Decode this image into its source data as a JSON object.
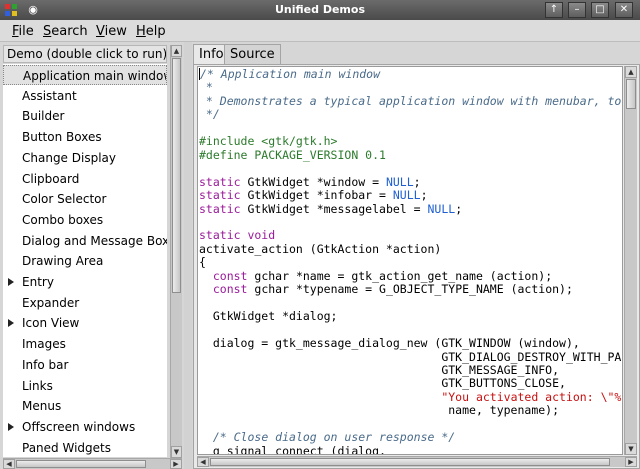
{
  "window": {
    "title": "Unified Demos",
    "buttons": [
      "↑",
      "–",
      "□",
      "✕"
    ]
  },
  "menubar": {
    "items": [
      {
        "label": "File",
        "mnemonic": "F",
        "rest": "ile"
      },
      {
        "label": "Search",
        "mnemonic": "S",
        "rest": "earch"
      },
      {
        "label": "View",
        "mnemonic": "V",
        "rest": "iew"
      },
      {
        "label": "Help",
        "mnemonic": "H",
        "rest": "elp"
      }
    ]
  },
  "demo_list": {
    "header": "Demo (double click to run)",
    "items": [
      {
        "label": "Application main window",
        "expandable": false,
        "selected": true
      },
      {
        "label": "Assistant",
        "expandable": false
      },
      {
        "label": "Builder",
        "expandable": false
      },
      {
        "label": "Button Boxes",
        "expandable": false
      },
      {
        "label": "Change Display",
        "expandable": false
      },
      {
        "label": "Clipboard",
        "expandable": false
      },
      {
        "label": "Color Selector",
        "expandable": false
      },
      {
        "label": "Combo boxes",
        "expandable": false
      },
      {
        "label": "Dialog and Message Boxes",
        "expandable": false
      },
      {
        "label": "Drawing Area",
        "expandable": false
      },
      {
        "label": "Entry",
        "expandable": true
      },
      {
        "label": "Expander",
        "expandable": false
      },
      {
        "label": "Icon View",
        "expandable": true
      },
      {
        "label": "Images",
        "expandable": false
      },
      {
        "label": "Info bar",
        "expandable": false
      },
      {
        "label": "Links",
        "expandable": false
      },
      {
        "label": "Menus",
        "expandable": false
      },
      {
        "label": "Offscreen windows",
        "expandable": true
      },
      {
        "label": "Paned Widgets",
        "expandable": false
      }
    ]
  },
  "tabs": [
    {
      "label": "Info",
      "active": true
    },
    {
      "label": "Source",
      "active": false
    }
  ],
  "source_lines": [
    [
      [
        "c",
        "/* Application main window"
      ]
    ],
    [
      [
        "c",
        " *"
      ]
    ],
    [
      [
        "c",
        " * Demonstrates a typical application window with menubar, toolbar, statusbar."
      ]
    ],
    [
      [
        "c",
        " */"
      ]
    ],
    [
      [
        "p",
        ""
      ]
    ],
    [
      [
        "p",
        "#include <gtk/gtk.h>"
      ]
    ],
    [
      [
        "p",
        "#define PACKAGE_VERSION 0.1"
      ]
    ],
    [
      [
        "t",
        ""
      ]
    ],
    [
      [
        "k",
        "static "
      ],
      [
        "t",
        "GtkWidget *window = "
      ],
      [
        "n",
        "NULL"
      ],
      [
        "t",
        ";"
      ]
    ],
    [
      [
        "k",
        "static "
      ],
      [
        "t",
        "GtkWidget *infobar = "
      ],
      [
        "n",
        "NULL"
      ],
      [
        "t",
        ";"
      ]
    ],
    [
      [
        "k",
        "static "
      ],
      [
        "t",
        "GtkWidget *messagelabel = "
      ],
      [
        "n",
        "NULL"
      ],
      [
        "t",
        ";"
      ]
    ],
    [
      [
        "t",
        ""
      ]
    ],
    [
      [
        "k",
        "static void"
      ]
    ],
    [
      [
        "t",
        "activate_action (GtkAction *action)"
      ]
    ],
    [
      [
        "t",
        "{"
      ]
    ],
    [
      [
        "t",
        "  "
      ],
      [
        "k",
        "const "
      ],
      [
        "t",
        "gchar *name = gtk_action_get_name (action);"
      ]
    ],
    [
      [
        "t",
        "  "
      ],
      [
        "k",
        "const "
      ],
      [
        "t",
        "gchar *typename = G_OBJECT_TYPE_NAME (action);"
      ]
    ],
    [
      [
        "t",
        ""
      ]
    ],
    [
      [
        "t",
        "  GtkWidget *dialog;"
      ]
    ],
    [
      [
        "t",
        ""
      ]
    ],
    [
      [
        "t",
        "  dialog = gtk_message_dialog_new (GTK_WINDOW (window),"
      ]
    ],
    [
      [
        "t",
        "                                   GTK_DIALOG_DESTROY_WITH_PARENT,"
      ]
    ],
    [
      [
        "t",
        "                                   GTK_MESSAGE_INFO,"
      ]
    ],
    [
      [
        "t",
        "                                   GTK_BUTTONS_CLOSE,"
      ]
    ],
    [
      [
        "t",
        "                                   "
      ],
      [
        "s",
        "\"You activated action: \\\"%s\\\" of type \\\"%s\\\"\""
      ],
      [
        "t",
        ","
      ]
    ],
    [
      [
        "t",
        "                                    name, typename);"
      ]
    ],
    [
      [
        "t",
        ""
      ]
    ],
    [
      [
        "t",
        "  "
      ],
      [
        "c",
        "/* Close dialog on user response */"
      ]
    ],
    [
      [
        "t",
        "  g_signal_connect (dialog,"
      ]
    ]
  ]
}
